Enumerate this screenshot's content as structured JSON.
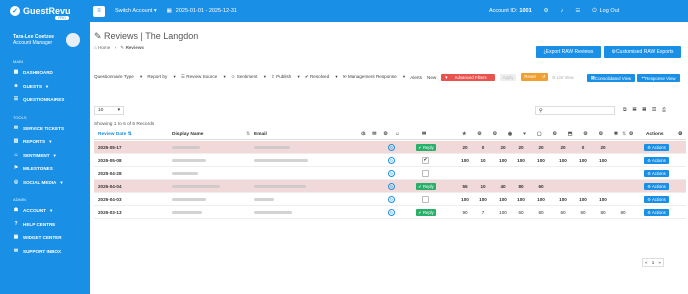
{
  "app": {
    "name": "GuestRevu",
    "badge": "PRO"
  },
  "user": {
    "name": "Tara-Lee Coetzee",
    "role": "Account Manager"
  },
  "nav": {
    "main_label": "MAIN",
    "dashboard": "DASHBOARD",
    "guests": "GUESTS",
    "reviews": "REVIEWS",
    "questionnaires": "QUESTIONNAIRES",
    "tools_label": "TOOLS",
    "service_tickets": "SERVICE TICKETS",
    "reports": "REPORTS",
    "sentiment": "SENTIMENT",
    "milestones": "MILESTONES",
    "social_media": "SOCIAL MEDIA",
    "admin_label": "ADMIN",
    "account": "ACCOUNT",
    "help_centre": "HELP CENTRE",
    "widget_center": "WIDGET CENTER",
    "support_inbox": "SUPPORT INBOX"
  },
  "topbar": {
    "switch_account": "Switch Account",
    "date_range": "2025-01-01 - 2025-12-31",
    "account_id_label": "Account ID:",
    "account_id": "1001",
    "logout": "Log Out"
  },
  "page": {
    "title": "Reviews | The Langdon",
    "breadcrumb_home": "Home",
    "breadcrumb_current": "Reviews"
  },
  "buttons": {
    "export_raw": "Export RAW Reviews",
    "custom_raw": "Customised RAW Exports",
    "list_view": "List View",
    "consolidated": "Consolidated View",
    "response": "Response View",
    "reply": "Reply",
    "actions": "Actions"
  },
  "filters": {
    "questionnaire_type": "Questionnaire Type",
    "report_by": "Report by",
    "review_source": "Review Source",
    "sentiment": "Sentiment",
    "publish": "Publish",
    "resolved": "Resolved",
    "mgmt_response": "Management Response",
    "alerts": "Alerts",
    "new": "New",
    "advanced": "Advanced Filters",
    "apply": "Apply",
    "reset": "Reset"
  },
  "table": {
    "page_size": "10",
    "showing": "Showing 1 to 6 of 6 Records",
    "headers": {
      "date": "Review Date",
      "name": "Display Name",
      "email": "Email",
      "actions": "Actions"
    },
    "rows": [
      {
        "date": "2025-05-17",
        "scores": [
          "20",
          "0",
          "20",
          "20",
          "20",
          "20",
          "0",
          "20"
        ],
        "reply": true,
        "check": "",
        "highlight": true
      },
      {
        "date": "2025-05-08",
        "scores": [
          "100",
          "10",
          "100",
          "100",
          "100",
          "100",
          "100",
          "100"
        ],
        "reply": false,
        "check": "✔",
        "highlight": false
      },
      {
        "date": "2025-04-28",
        "scores": [
          "",
          "",
          "",
          "",
          "",
          "",
          "",
          ""
        ],
        "reply": false,
        "check": "",
        "highlight": false
      },
      {
        "date": "2025-04-04",
        "scores": [
          "55",
          "10",
          "40",
          "80",
          "60",
          "",
          "",
          ""
        ],
        "reply": true,
        "check": "",
        "highlight": true
      },
      {
        "date": "2025-04-03",
        "scores": [
          "100",
          "100",
          "100",
          "100",
          "100",
          "100",
          "100",
          "100"
        ],
        "reply": false,
        "check": "",
        "highlight": false
      },
      {
        "date": "2025-03-13",
        "scores": [
          "90",
          "7",
          "100",
          "60",
          "80",
          "60",
          "60",
          "80",
          "80"
        ],
        "reply": true,
        "check": "",
        "highlight": false
      }
    ],
    "pagination": {
      "prev": "«",
      "page": "1",
      "next": "»"
    }
  },
  "colors": {
    "primary": "#1a8fe6",
    "nav_active": "#1b62a6",
    "highlight_row": "#f1d9da",
    "reply": "#28b06a",
    "advanced": "#e8534f",
    "reset": "#f0a030"
  }
}
